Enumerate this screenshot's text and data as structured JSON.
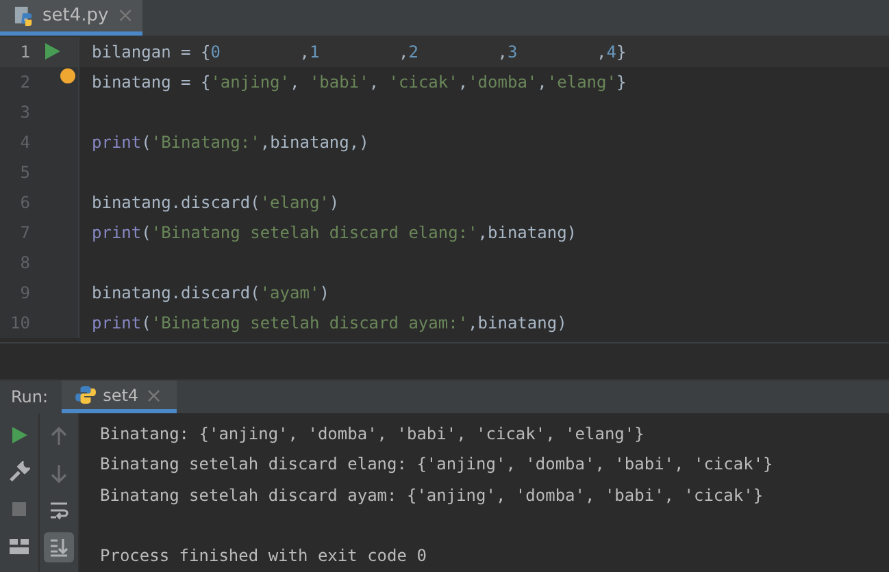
{
  "editor_tabs": [
    {
      "label": "set4.py",
      "close": "×",
      "selected": true
    }
  ],
  "code_lines": [
    {
      "number": "1",
      "current": true,
      "run_button": true,
      "tokens": [
        {
          "text": "bilangan = {",
          "kind": "ident"
        },
        {
          "text": "0",
          "kind": "number"
        },
        {
          "text": "        ,",
          "kind": "punct"
        },
        {
          "text": "1",
          "kind": "number"
        },
        {
          "text": "        ,",
          "kind": "punct"
        },
        {
          "text": "2",
          "kind": "number"
        },
        {
          "text": "        ,",
          "kind": "punct"
        },
        {
          "text": "3",
          "kind": "number"
        },
        {
          "text": "        ,",
          "kind": "punct"
        },
        {
          "text": "4",
          "kind": "number"
        },
        {
          "text": "}",
          "kind": "punct"
        }
      ]
    },
    {
      "number": "2",
      "current": false,
      "bulb": true,
      "tokens": [
        {
          "text": "binatang = {",
          "kind": "ident"
        },
        {
          "text": "'anjing'",
          "kind": "string"
        },
        {
          "text": ", ",
          "kind": "punct"
        },
        {
          "text": "'babi'",
          "kind": "string"
        },
        {
          "text": ", ",
          "kind": "punct"
        },
        {
          "text": "'cicak'",
          "kind": "string"
        },
        {
          "text": ",",
          "kind": "punct"
        },
        {
          "text": "'domba'",
          "kind": "string"
        },
        {
          "text": ",",
          "kind": "punct"
        },
        {
          "text": "'elang'",
          "kind": "string"
        },
        {
          "text": "}",
          "kind": "punct"
        }
      ]
    },
    {
      "number": "3",
      "current": false
    },
    {
      "number": "4",
      "current": false,
      "tokens": [
        {
          "text": "print",
          "kind": "builtin"
        },
        {
          "text": "(",
          "kind": "punct"
        },
        {
          "text": "'Binatang:'",
          "kind": "string"
        },
        {
          "text": ",binatang,)",
          "kind": "ident"
        }
      ]
    },
    {
      "number": "5",
      "current": false
    },
    {
      "number": "6",
      "current": false,
      "tokens": [
        {
          "text": "binatang.discard(",
          "kind": "ident"
        },
        {
          "text": "'elang'",
          "kind": "string"
        },
        {
          "text": ")",
          "kind": "punct"
        }
      ]
    },
    {
      "number": "7",
      "current": false,
      "tokens": [
        {
          "text": "print",
          "kind": "builtin"
        },
        {
          "text": "(",
          "kind": "punct"
        },
        {
          "text": "'Binatang setelah discard elang:'",
          "kind": "string"
        },
        {
          "text": ",binatang)",
          "kind": "ident"
        }
      ]
    },
    {
      "number": "8",
      "current": false
    },
    {
      "number": "9",
      "current": false,
      "tokens": [
        {
          "text": "binatang.discard(",
          "kind": "ident"
        },
        {
          "text": "'ayam'",
          "kind": "string"
        },
        {
          "text": ")",
          "kind": "punct"
        }
      ]
    },
    {
      "number": "10",
      "current": false,
      "tokens": [
        {
          "text": "print",
          "kind": "builtin"
        },
        {
          "text": "(",
          "kind": "punct"
        },
        {
          "text": "'Binatang setelah discard ayam:'",
          "kind": "string"
        },
        {
          "text": ",binatang)",
          "kind": "ident"
        }
      ]
    }
  ],
  "run_panel": {
    "label": "Run:",
    "tabs": [
      {
        "label": "set4",
        "close": "×",
        "selected": true
      }
    ],
    "toolbar": [
      {
        "kind": "run",
        "disabled": false
      },
      {
        "kind": "wrench",
        "disabled": false
      },
      {
        "kind": "stop",
        "disabled": true
      },
      {
        "kind": "layout",
        "disabled": false
      }
    ],
    "toolbar_2": [
      {
        "kind": "up",
        "disabled": true,
        "selected": false
      },
      {
        "kind": "down",
        "disabled": true,
        "selected": false
      },
      {
        "kind": "wrap",
        "disabled": false,
        "selected": false
      },
      {
        "kind": "scroll-end",
        "disabled": false,
        "selected": true
      }
    ],
    "output": [
      "Binatang: {'anjing', 'domba', 'babi', 'cicak', 'elang'}",
      "Binatang setelah discard elang: {'anjing', 'domba', 'babi', 'cicak'}",
      "Binatang setelah discard ayam: {'anjing', 'domba', 'babi', 'cicak'}"
    ],
    "exit_message": "Process finished with exit code 0"
  }
}
